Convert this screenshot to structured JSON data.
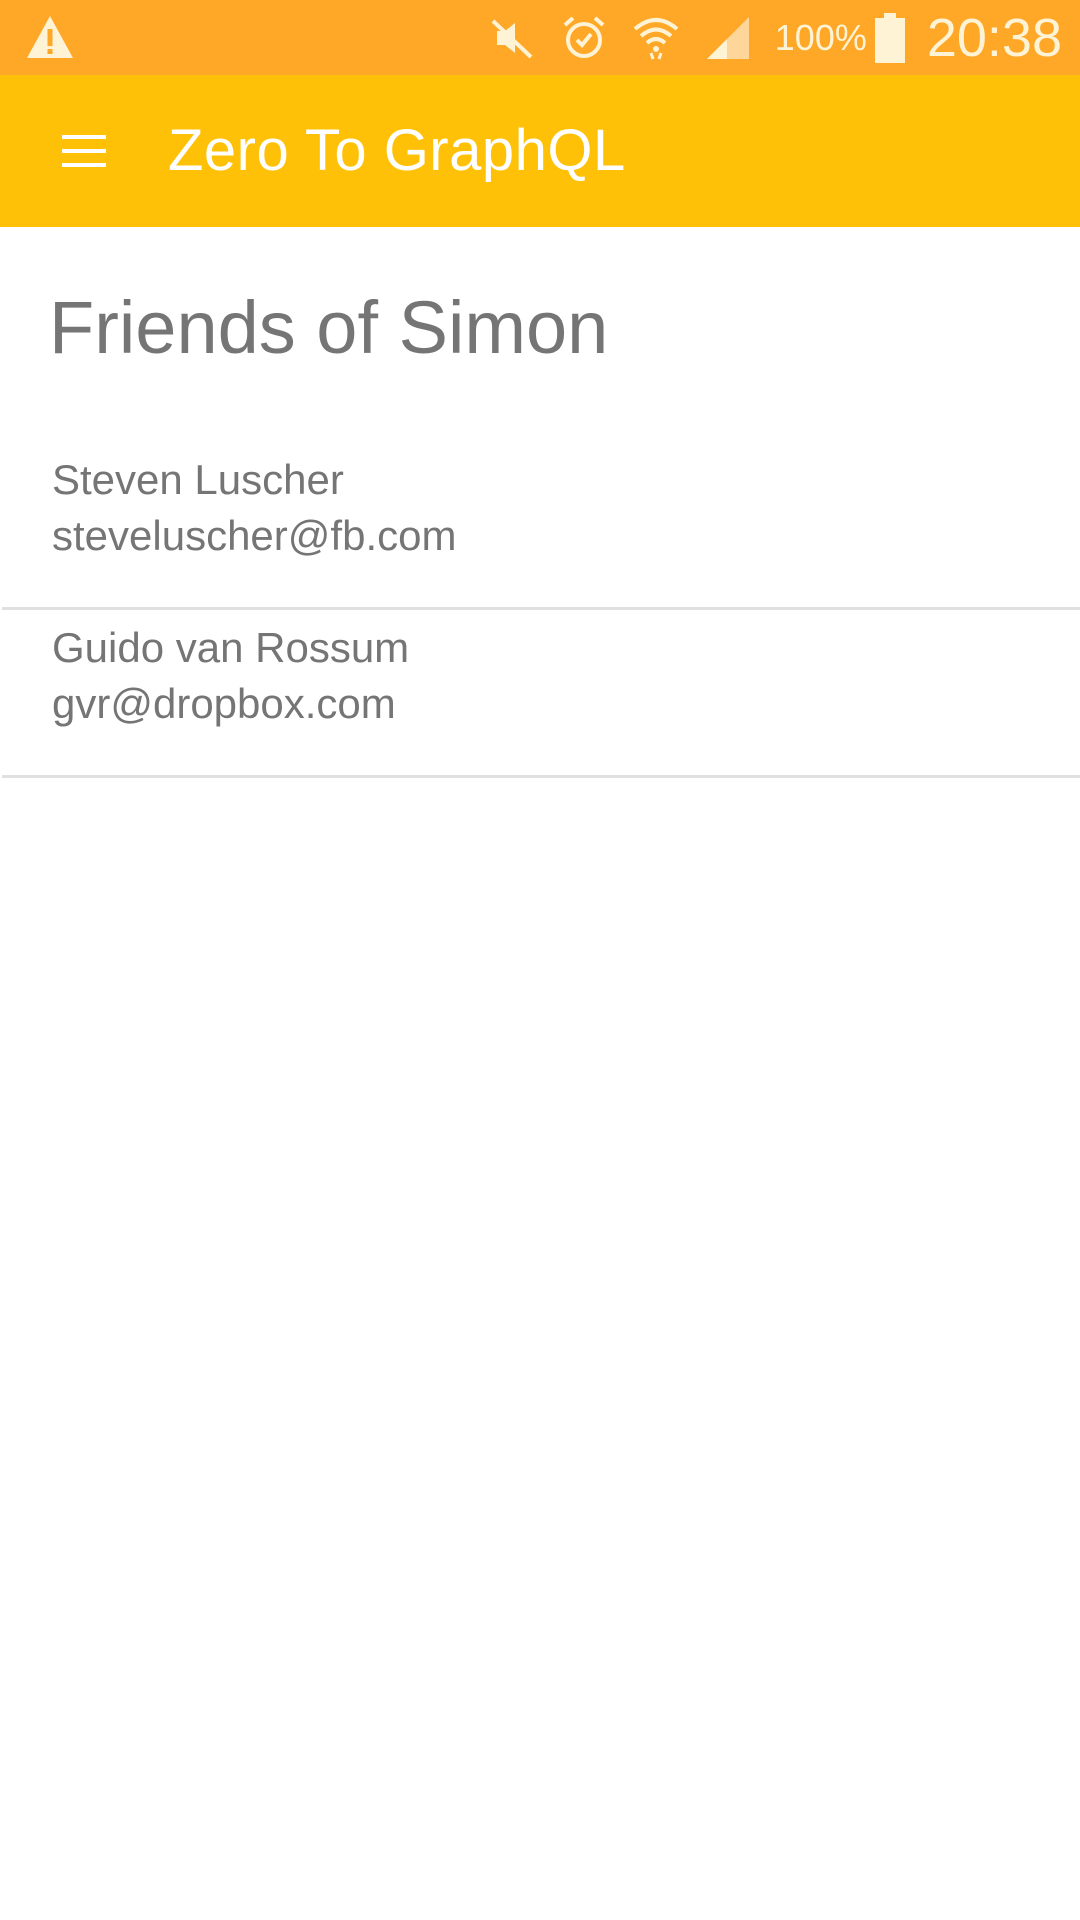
{
  "status_bar": {
    "battery_percent": "100%",
    "time": "20:38",
    "icons": [
      "warning-icon",
      "mute-icon",
      "alarm-icon",
      "wifi-icon",
      "signal-icon",
      "battery-icon"
    ]
  },
  "app_bar": {
    "title": "Zero To GraphQL",
    "menu_icon": "menu-icon"
  },
  "page": {
    "heading": "Friends of Simon"
  },
  "friends": [
    {
      "name": "Steven Luscher",
      "email": "steveluscher@fb.com"
    },
    {
      "name": "Guido van Rossum",
      "email": "gvr@dropbox.com"
    }
  ],
  "colors": {
    "status_bar": "#FFA726",
    "app_bar": "#FFC107",
    "text": "#757575",
    "divider": "#E0E0E0"
  }
}
